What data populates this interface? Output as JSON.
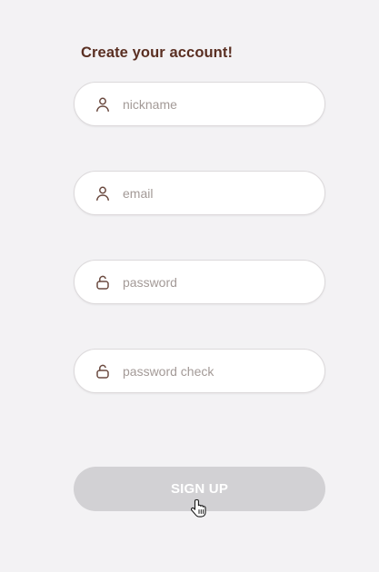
{
  "form": {
    "title": "Create your account!",
    "fields": [
      {
        "icon": "user-icon",
        "placeholder": "nickname",
        "value": ""
      },
      {
        "icon": "user-icon",
        "placeholder": "email",
        "value": ""
      },
      {
        "icon": "lock-icon",
        "placeholder": "password",
        "value": ""
      },
      {
        "icon": "lock-icon",
        "placeholder": "password check",
        "value": ""
      }
    ],
    "submit_label": "SIGN UP"
  },
  "colors": {
    "background": "#f3f2f4",
    "title": "#5a2f22",
    "icon": "#6b4a40",
    "placeholder": "#a39a97",
    "button_disabled": "#d2d1d4"
  }
}
